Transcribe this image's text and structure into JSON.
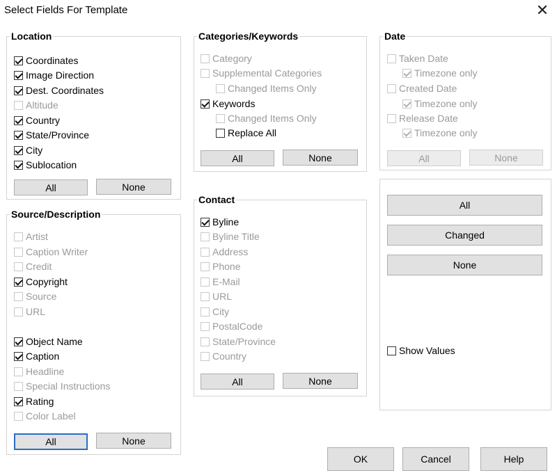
{
  "window": {
    "title": "Select Fields For Template",
    "close_symbol": "✕"
  },
  "location": {
    "title": "Location",
    "items": [
      {
        "label": "Coordinates",
        "checked": true,
        "enabled": true
      },
      {
        "label": "Image Direction",
        "checked": true,
        "enabled": true
      },
      {
        "label": "Dest. Coordinates",
        "checked": true,
        "enabled": true
      },
      {
        "label": "Altitude",
        "checked": false,
        "enabled": false
      },
      {
        "label": "Country",
        "checked": true,
        "enabled": true
      },
      {
        "label": "State/Province",
        "checked": true,
        "enabled": true
      },
      {
        "label": "City",
        "checked": true,
        "enabled": true
      },
      {
        "label": "Sublocation",
        "checked": true,
        "enabled": true
      }
    ],
    "all_label": "All",
    "none_label": "None"
  },
  "source": {
    "title": "Source/Description",
    "items": [
      {
        "label": "Artist",
        "checked": false,
        "enabled": false
      },
      {
        "label": "Caption Writer",
        "checked": false,
        "enabled": false
      },
      {
        "label": "Credit",
        "checked": false,
        "enabled": false
      },
      {
        "label": "Copyright",
        "checked": true,
        "enabled": true
      },
      {
        "label": "Source",
        "checked": false,
        "enabled": false
      },
      {
        "label": "URL",
        "checked": false,
        "enabled": false
      },
      {
        "label": "Object Name",
        "checked": true,
        "enabled": true
      },
      {
        "label": "Caption",
        "checked": true,
        "enabled": true
      },
      {
        "label": "Headline",
        "checked": false,
        "enabled": false
      },
      {
        "label": "Special Instructions",
        "checked": false,
        "enabled": false
      },
      {
        "label": "Rating",
        "checked": true,
        "enabled": true
      },
      {
        "label": "Color Label",
        "checked": false,
        "enabled": false
      }
    ],
    "all_label": "All",
    "none_label": "None"
  },
  "categories": {
    "title": "Categories/Keywords",
    "items": [
      {
        "label": "Category",
        "checked": false,
        "enabled": false
      },
      {
        "label": "Supplemental Categories",
        "checked": false,
        "enabled": false
      },
      {
        "label": "Changed Items Only",
        "checked": false,
        "enabled": false
      },
      {
        "label": "Keywords",
        "checked": true,
        "enabled": true
      },
      {
        "label": "Changed Items Only",
        "checked": false,
        "enabled": false
      },
      {
        "label": "Replace All",
        "checked": false,
        "enabled": true
      }
    ],
    "all_label": "All",
    "none_label": "None"
  },
  "contact": {
    "title": "Contact",
    "items": [
      {
        "label": "Byline",
        "checked": true,
        "enabled": true
      },
      {
        "label": "Byline Title",
        "checked": false,
        "enabled": false
      },
      {
        "label": "Address",
        "checked": false,
        "enabled": false
      },
      {
        "label": "Phone",
        "checked": false,
        "enabled": false
      },
      {
        "label": "E-Mail",
        "checked": false,
        "enabled": false
      },
      {
        "label": "URL",
        "checked": false,
        "enabled": false
      },
      {
        "label": "City",
        "checked": false,
        "enabled": false
      },
      {
        "label": "PostalCode",
        "checked": false,
        "enabled": false
      },
      {
        "label": "State/Province",
        "checked": false,
        "enabled": false
      },
      {
        "label": "Country",
        "checked": false,
        "enabled": false
      }
    ],
    "all_label": "All",
    "none_label": "None"
  },
  "date": {
    "title": "Date",
    "items": [
      {
        "label": "Taken Date",
        "checked": false,
        "enabled": false
      },
      {
        "label": "Timezone only",
        "checked": true,
        "enabled": false
      },
      {
        "label": "Created Date",
        "checked": false,
        "enabled": false
      },
      {
        "label": "Timezone only",
        "checked": true,
        "enabled": false
      },
      {
        "label": "Release Date",
        "checked": false,
        "enabled": false
      },
      {
        "label": "Timezone only",
        "checked": true,
        "enabled": false
      }
    ],
    "all_label": "All",
    "none_label": "None"
  },
  "global": {
    "all_label": "All",
    "changed_label": "Changed",
    "none_label": "None",
    "show_values": {
      "label": "Show Values",
      "checked": false,
      "enabled": true
    }
  },
  "footer": {
    "ok_label": "OK",
    "cancel_label": "Cancel",
    "help_label": "Help"
  }
}
